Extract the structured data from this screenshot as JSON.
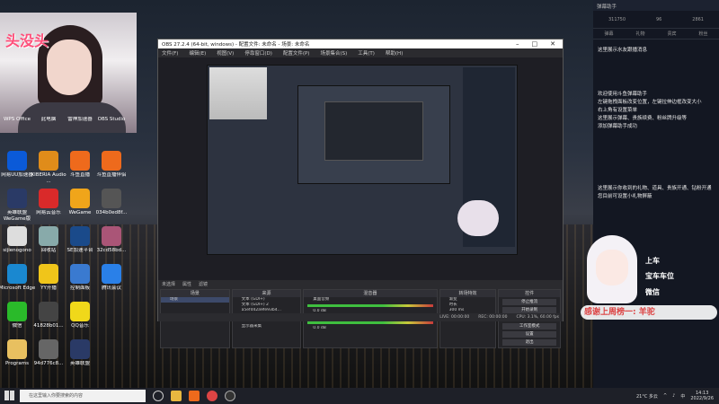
{
  "webcam": {
    "overlay_text": "头没头"
  },
  "desktop_icons": [
    {
      "label": "WPS Office",
      "color": "#d33"
    },
    {
      "label": "此电脑",
      "color": "#4a8bd8"
    },
    {
      "label": "雷神加速器",
      "color": "#2a6fd6"
    },
    {
      "label": "OBS Studio",
      "color": "#333"
    },
    {
      "label": "网易UU加速器",
      "color": "#0b5ad8"
    },
    {
      "label": "XIBERIA Audio ...",
      "color": "#e08c1a"
    },
    {
      "label": "斗鱼直播",
      "color": "#ee6a1c"
    },
    {
      "label": "斗鱼直播伴侣",
      "color": "#ee6a1c"
    },
    {
      "label": "英雄联盟 WeGame版",
      "color": "#2a3a66"
    },
    {
      "label": "网易云音乐",
      "color": "#d92a2a"
    },
    {
      "label": "WeGame",
      "color": "#f0a51a"
    },
    {
      "label": "034b0ed8f...",
      "color": "#555"
    },
    {
      "label": "sijienogono",
      "color": "#ddd"
    },
    {
      "label": "回收站",
      "color": "#8aa"
    },
    {
      "label": "SE加速平台",
      "color": "#1a4a8a"
    },
    {
      "label": "32cd58bd...",
      "color": "#a57"
    },
    {
      "label": "Microsoft Edge",
      "color": "#1a88d0"
    },
    {
      "label": "YY开播",
      "color": "#f0c51a"
    },
    {
      "label": "控制面板",
      "color": "#3a7ad0"
    },
    {
      "label": "腾讯会议",
      "color": "#2a80e8"
    },
    {
      "label": "微信",
      "color": "#2aba2a"
    },
    {
      "label": "41828b01...",
      "color": "#444"
    },
    {
      "label": "QQ音乐",
      "color": "#f0d81a"
    },
    {
      "label": "Programs",
      "color": "#e8c060"
    },
    {
      "label": "94d776c8...",
      "color": "#666"
    },
    {
      "label": "英雄联盟",
      "color": "#2a3a66"
    }
  ],
  "obs": {
    "title": "OBS 27.2.4 (64-bit, windows) - 配置文件: 未命名 - 场景: 未命名",
    "menu": [
      "文件(F)",
      "编辑(E)",
      "视图(V)",
      "停靠窗口(D)",
      "配置文件(P)",
      "场景集合(S)",
      "工具(T)",
      "帮助(H)"
    ],
    "scene_bar": [
      "未选择",
      "属性",
      "滤镜"
    ],
    "docks": {
      "scenes": {
        "header": "场景",
        "items": [
          "场景"
        ]
      },
      "sources": {
        "header": "来源",
        "items": [
          "文本 (GDI+)",
          "文本 (GDI+) 2",
          "a5efd42a9fe93b4...",
          "5b4f76e0f90f3b2...",
          "52f8c834b2d4ad80...",
          "显示器采集"
        ]
      },
      "mixer": {
        "header": "混音器",
        "channels": [
          "桌面音频",
          "麦克风"
        ],
        "db": [
          "0.0 dB",
          "0.0 dB"
        ]
      },
      "transitions": {
        "header": "转场特效",
        "type": "渐变",
        "duration_label": "时长",
        "duration": "300 ms"
      },
      "controls": {
        "header": "控件",
        "buttons": [
          "停止推流",
          "开始录制",
          "启动虚拟摄像机",
          "工作室模式",
          "设置",
          "退出"
        ]
      }
    },
    "status": [
      "LIVE: 00:00:00",
      "REC: 00:00:00",
      "CPU: 3.1%, 60.00 fps"
    ]
  },
  "panel": {
    "title": "弹幕助手",
    "stats": [
      "311750",
      "96",
      "2861"
    ],
    "tabs": [
      "弹幕",
      "礼物",
      "贵宾",
      "粉丝"
    ],
    "messages": [
      "这里展示水友跟播消息",
      "欢迎使用斗鱼弹幕助手",
      "左键拖拽面板改变位置，左键拉伸边框改变大小",
      "右上角有设置菜单",
      "这里展示弹幕、贵族续费、粉丝牌升级等",
      "添加弹幕助手成功",
      "这里展示你收到的礼物、道具、贵族开通、钻粉开通",
      "您目前可设置小礼物屏蔽"
    ]
  },
  "overlay": {
    "gifts": [
      "上车",
      "宝车车位",
      "微信"
    ],
    "ticker": "感谢上周榜一: 羊驼"
  },
  "taskbar": {
    "search_placeholder": "在这里输入你要搜索的内容",
    "weather": "21°C 多云",
    "time": "14:13",
    "date": "2022/9/26"
  }
}
